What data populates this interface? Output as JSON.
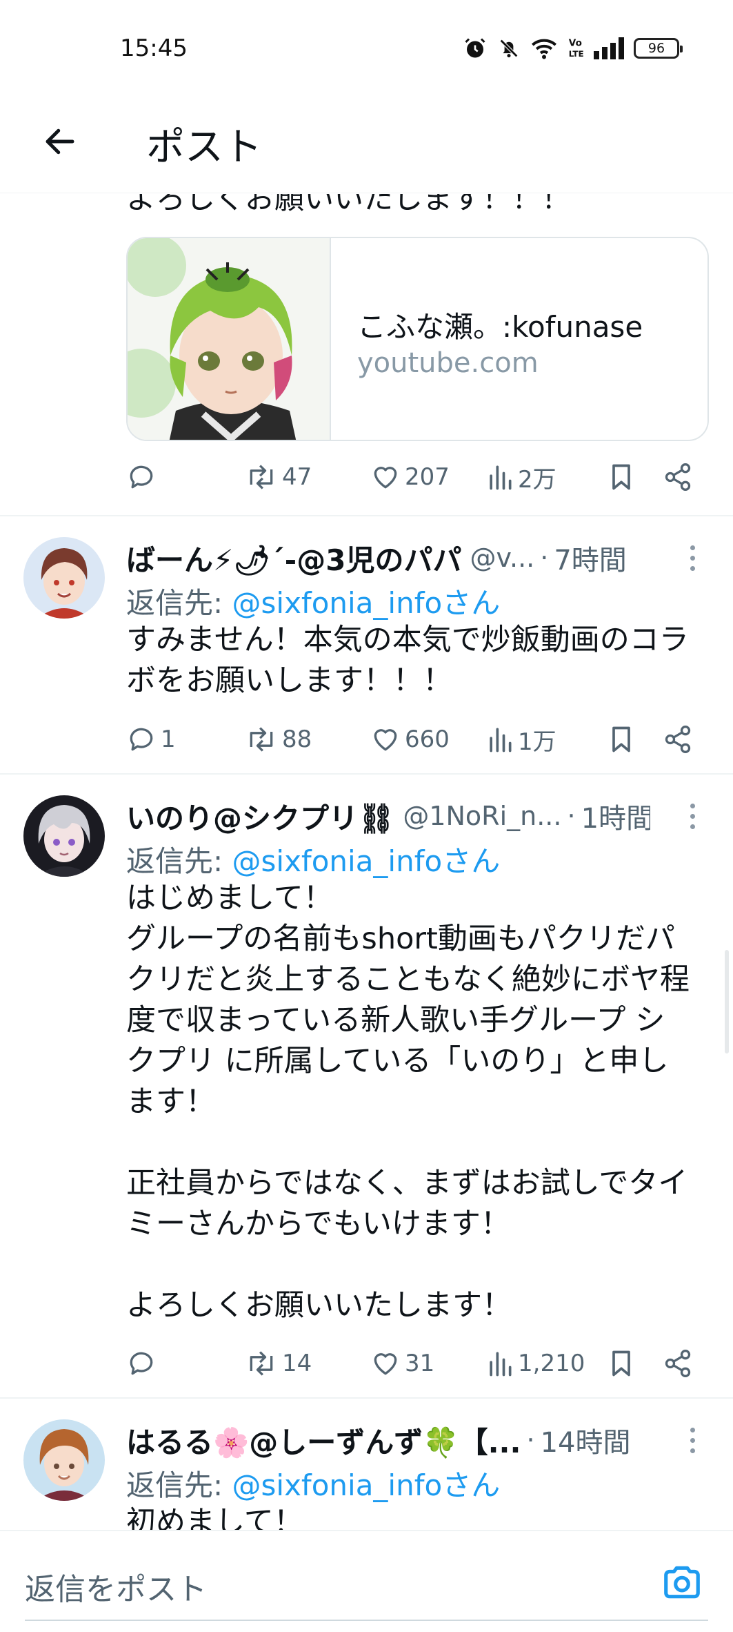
{
  "status_bar": {
    "time": "15:45",
    "battery": "96"
  },
  "header": {
    "title": "ポスト"
  },
  "partial_post": {
    "text_tail": "よろしくお願いいたします！！！",
    "card": {
      "title": "こふな瀬。:kofunase",
      "domain": "youtube.com"
    },
    "actions": {
      "reply": "",
      "repost": "47",
      "like": "207",
      "views": "2万"
    }
  },
  "replies": [
    {
      "name": "ばーん⚡🌶´-@3児のパパ",
      "handle": "@v...",
      "time": "7時間",
      "reply_label": "返信先: ",
      "reply_to": "@sixfonia_infoさん",
      "body": "すみません！本気の本気で炒飯動画のコラ\nボをお願いします！！！",
      "actions": {
        "reply": "1",
        "repost": "88",
        "like": "660",
        "views": "1万"
      },
      "avatar_colors": {
        "hair": "#7a3b2e",
        "bg": "#dbe7f5",
        "shirt": "#c0392b"
      }
    },
    {
      "name": "いのり@シクプリ⛓",
      "handle": "@1NoRi_n...",
      "time": "1時間",
      "reply_label": "返信先: ",
      "reply_to": "@sixfonia_infoさん",
      "body": "はじめまして！\nグループの名前もshort動画もパクリだパ\nクリだと炎上することもなく絶妙にボヤ程\n度で収まっている新人歌い手グループ シ\nクプリ に所属している「いのり」と申し\nます！\n\n正社員からではなく、まずはお試しでタイ\nミーさんからでもいけます！\n\nよろしくお願いいたします！",
      "actions": {
        "reply": "",
        "repost": "14",
        "like": "31",
        "views": "1,210"
      },
      "avatar_colors": {
        "hair": "#cfcfd6",
        "bg": "#1b1b22",
        "shirt": "#2a2a33"
      }
    },
    {
      "name": "はるる🌸@しーずんず🍀【...",
      "handle": "",
      "time": "14時間",
      "reply_label": "返信先: ",
      "reply_to": "@sixfonia_infoさん",
      "body": "初めまして！",
      "avatar_colors": {
        "hair": "#b5652f",
        "bg": "#c9e2f2",
        "shirt": "#7a2d3b"
      }
    }
  ],
  "composer": {
    "placeholder": "返信をポスト"
  },
  "colors": {
    "accent": "#1d9bf0",
    "muted": "#536471",
    "text": "#0f1419"
  }
}
